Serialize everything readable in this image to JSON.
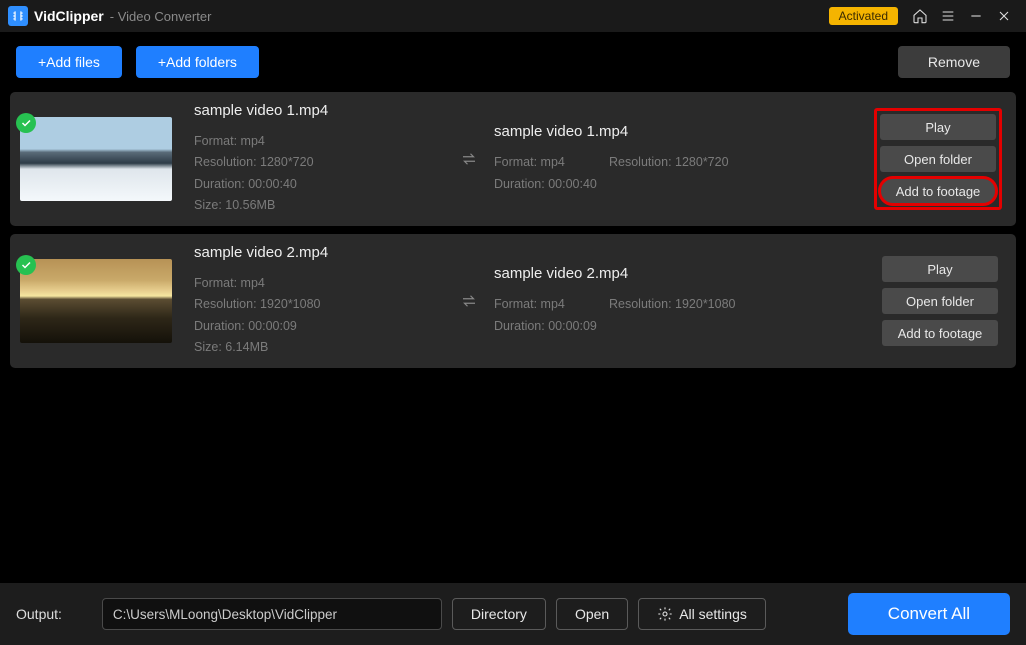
{
  "title": {
    "app": "VidClipper",
    "sub": "- Video Converter",
    "badge": "Activated"
  },
  "toolbar": {
    "add_files": "+Add files",
    "add_folders": "+Add folders",
    "remove": "Remove"
  },
  "actions": {
    "play": "Play",
    "open_folder": "Open folder",
    "add_footage": "Add to footage"
  },
  "rows": [
    {
      "src_name": "sample video 1.mp4",
      "src_format_l": "Format: mp4",
      "src_res": "Resolution: 1280*720",
      "src_dur": "Duration: 00:00:40",
      "src_size": "Size: 10.56MB",
      "dst_name": "sample video 1.mp4",
      "dst_format_l": "Format: mp4",
      "dst_res": "Resolution: 1280*720",
      "dst_dur": "Duration: 00:00:40"
    },
    {
      "src_name": "sample video 2.mp4",
      "src_format_l": "Format: mp4",
      "src_res": "Resolution: 1920*1080",
      "src_dur": "Duration: 00:00:09",
      "src_size": "Size: 6.14MB",
      "dst_name": "sample video 2.mp4",
      "dst_format_l": "Format: mp4",
      "dst_res": "Resolution: 1920*1080",
      "dst_dur": "Duration: 00:00:09"
    }
  ],
  "footer": {
    "output_label": "Output:",
    "path": "C:\\Users\\MLoong\\Desktop\\VidClipper",
    "directory": "Directory",
    "open": "Open",
    "all_settings": "All settings",
    "convert": "Convert All"
  }
}
